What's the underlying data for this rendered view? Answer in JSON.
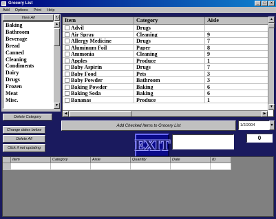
{
  "window": {
    "title": "Grocery List",
    "controls": [
      "_",
      "□",
      "×"
    ]
  },
  "menu": [
    "Add",
    "Options",
    "Print",
    "Help"
  ],
  "left": {
    "view_all": "View All",
    "categories": [
      "Baking",
      "Bathroom",
      "Beverage",
      "Bread",
      "Canned",
      "Cleaning",
      "Condiments",
      "Dairy",
      "Drugs",
      "Frozen",
      "Meat",
      "Misc."
    ],
    "delete_category": "Delete Category",
    "change_dates": "Change dates below",
    "delete_all": "Delete All",
    "click_if_not_updating": "Click if not updating"
  },
  "grid": {
    "columns": [
      "Item",
      "Category",
      "Aisle"
    ],
    "rows": [
      {
        "item": "Advil",
        "category": "Drugs",
        "aisle": ""
      },
      {
        "item": "Air Spray",
        "category": "Cleaning",
        "aisle": "9"
      },
      {
        "item": "Allergy Medicine",
        "category": "Drugs",
        "aisle": "7"
      },
      {
        "item": "Aluminum Foil",
        "category": "Paper",
        "aisle": "8"
      },
      {
        "item": "Ammonia",
        "category": "Cleaning",
        "aisle": "9"
      },
      {
        "item": "Apples",
        "category": "Produce",
        "aisle": "1"
      },
      {
        "item": "Baby Aspirin",
        "category": "Drugs",
        "aisle": "7"
      },
      {
        "item": "Baby Food",
        "category": "Pets",
        "aisle": "3"
      },
      {
        "item": "Baby Powder",
        "category": "Bathroom",
        "aisle": "3"
      },
      {
        "item": "Baking Powder",
        "category": "Baking",
        "aisle": "6"
      },
      {
        "item": "Baking Soda",
        "category": "Baking",
        "aisle": "6"
      },
      {
        "item": "Bananas",
        "category": "Produce",
        "aisle": "1"
      }
    ]
  },
  "actions": {
    "add_checked": "Add Checked Items to Grocery List",
    "date": "1/2/2004",
    "count": "0",
    "exit": "EXIT"
  },
  "list_grid": {
    "columns": [
      "Item",
      "Category",
      "Aisle",
      "Quantity",
      "Date",
      "ID"
    ]
  }
}
